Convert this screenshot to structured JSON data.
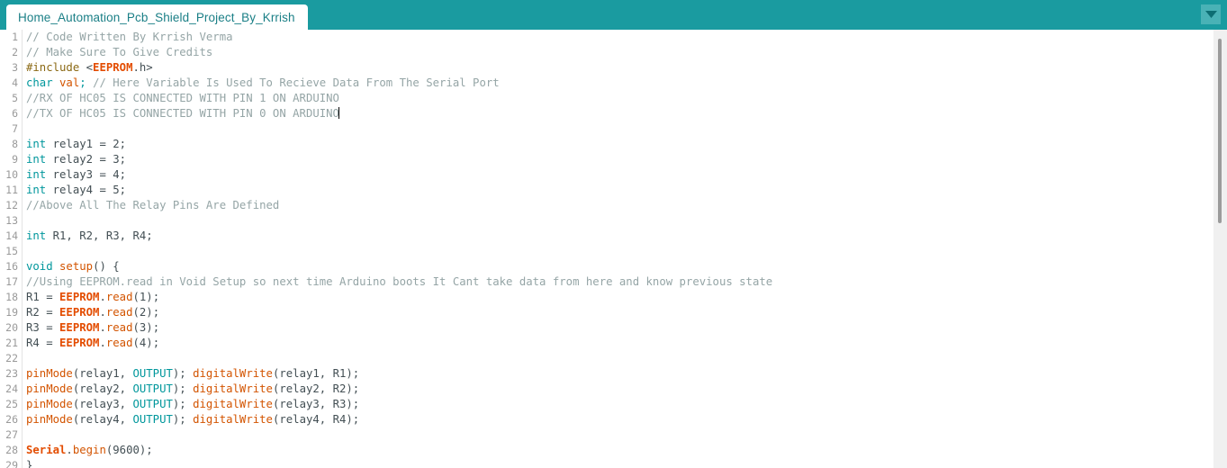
{
  "window": {
    "accent_color": "#1a9ba0",
    "tab_menu_icon": "chevron-down-icon"
  },
  "tab": {
    "label": "Home_Automation_Pcb_Shield_Project_By_Krrish"
  },
  "editor": {
    "language": "arduino-cpp",
    "caret_line": 6,
    "lines": [
      {
        "n": "1",
        "tokens": [
          {
            "t": "// Code Written By Krrish Verma",
            "c": "t-comment"
          }
        ]
      },
      {
        "n": "2",
        "tokens": [
          {
            "t": "// Make Sure To Give Credits",
            "c": "t-comment"
          }
        ]
      },
      {
        "n": "3",
        "tokens": [
          {
            "t": "#include",
            "c": "t-preproc"
          },
          {
            "t": " <",
            "c": "t-plain"
          },
          {
            "t": "EEPROM",
            "c": "t-lib"
          },
          {
            "t": ".h>",
            "c": "t-plain"
          }
        ]
      },
      {
        "n": "4",
        "tokens": [
          {
            "t": "char",
            "c": "t-keyword"
          },
          {
            "t": " ",
            "c": "t-plain"
          },
          {
            "t": "val",
            "c": "t-func"
          },
          {
            "t": ";",
            "c": "t-keyword"
          },
          {
            "t": " ",
            "c": "t-plain"
          },
          {
            "t": "// Here Variable Is Used To Recieve Data From The Serial Port",
            "c": "t-comment"
          }
        ]
      },
      {
        "n": "5",
        "tokens": [
          {
            "t": "//RX OF HC05 IS CONNECTED WITH PIN 1 ON ARDUINO",
            "c": "t-comment"
          }
        ]
      },
      {
        "n": "6",
        "tokens": [
          {
            "t": "//TX OF HC05 IS CONNECTED WITH PIN 0 ON ARDUINO",
            "c": "t-comment"
          }
        ]
      },
      {
        "n": "7",
        "tokens": [
          {
            "t": "",
            "c": "t-plain"
          }
        ]
      },
      {
        "n": "8",
        "tokens": [
          {
            "t": "int",
            "c": "t-keyword"
          },
          {
            "t": " relay1 = 2;",
            "c": "t-plain"
          }
        ]
      },
      {
        "n": "9",
        "tokens": [
          {
            "t": "int",
            "c": "t-keyword"
          },
          {
            "t": " relay2 = 3;",
            "c": "t-plain"
          }
        ]
      },
      {
        "n": "10",
        "tokens": [
          {
            "t": "int",
            "c": "t-keyword"
          },
          {
            "t": " relay3 = 4;",
            "c": "t-plain"
          }
        ]
      },
      {
        "n": "11",
        "tokens": [
          {
            "t": "int",
            "c": "t-keyword"
          },
          {
            "t": " relay4 = 5;",
            "c": "t-plain"
          }
        ]
      },
      {
        "n": "12",
        "tokens": [
          {
            "t": "//Above All The Relay Pins Are Defined",
            "c": "t-comment"
          }
        ]
      },
      {
        "n": "13",
        "tokens": [
          {
            "t": "",
            "c": "t-plain"
          }
        ]
      },
      {
        "n": "14",
        "tokens": [
          {
            "t": "int",
            "c": "t-keyword"
          },
          {
            "t": " R1, R2, R3, R4;",
            "c": "t-plain"
          }
        ]
      },
      {
        "n": "15",
        "tokens": [
          {
            "t": "",
            "c": "t-plain"
          }
        ]
      },
      {
        "n": "16",
        "tokens": [
          {
            "t": "void",
            "c": "t-keyword"
          },
          {
            "t": " ",
            "c": "t-plain"
          },
          {
            "t": "setup",
            "c": "t-func"
          },
          {
            "t": "() {",
            "c": "t-plain"
          }
        ]
      },
      {
        "n": "17",
        "tokens": [
          {
            "t": "//Using EEPROM.read in Void Setup so next time Arduino boots It Cant take data from here and know previous state",
            "c": "t-comment"
          }
        ]
      },
      {
        "n": "18",
        "tokens": [
          {
            "t": "R1 = ",
            "c": "t-plain"
          },
          {
            "t": "EEPROM",
            "c": "t-lib"
          },
          {
            "t": ".",
            "c": "t-plain"
          },
          {
            "t": "read",
            "c": "t-method"
          },
          {
            "t": "(1);",
            "c": "t-plain"
          }
        ]
      },
      {
        "n": "19",
        "tokens": [
          {
            "t": "R2 = ",
            "c": "t-plain"
          },
          {
            "t": "EEPROM",
            "c": "t-lib"
          },
          {
            "t": ".",
            "c": "t-plain"
          },
          {
            "t": "read",
            "c": "t-method"
          },
          {
            "t": "(2);",
            "c": "t-plain"
          }
        ]
      },
      {
        "n": "20",
        "tokens": [
          {
            "t": "R3 = ",
            "c": "t-plain"
          },
          {
            "t": "EEPROM",
            "c": "t-lib"
          },
          {
            "t": ".",
            "c": "t-plain"
          },
          {
            "t": "read",
            "c": "t-method"
          },
          {
            "t": "(3);",
            "c": "t-plain"
          }
        ]
      },
      {
        "n": "21",
        "tokens": [
          {
            "t": "R4 = ",
            "c": "t-plain"
          },
          {
            "t": "EEPROM",
            "c": "t-lib"
          },
          {
            "t": ".",
            "c": "t-plain"
          },
          {
            "t": "read",
            "c": "t-method"
          },
          {
            "t": "(4);",
            "c": "t-plain"
          }
        ]
      },
      {
        "n": "22",
        "tokens": [
          {
            "t": "",
            "c": "t-plain"
          }
        ]
      },
      {
        "n": "23",
        "tokens": [
          {
            "t": "pinMode",
            "c": "t-func"
          },
          {
            "t": "(relay1, ",
            "c": "t-plain"
          },
          {
            "t": "OUTPUT",
            "c": "t-const"
          },
          {
            "t": "); ",
            "c": "t-plain"
          },
          {
            "t": "digitalWrite",
            "c": "t-func"
          },
          {
            "t": "(relay1, R1);",
            "c": "t-plain"
          }
        ]
      },
      {
        "n": "24",
        "tokens": [
          {
            "t": "pinMode",
            "c": "t-func"
          },
          {
            "t": "(relay2, ",
            "c": "t-plain"
          },
          {
            "t": "OUTPUT",
            "c": "t-const"
          },
          {
            "t": "); ",
            "c": "t-plain"
          },
          {
            "t": "digitalWrite",
            "c": "t-func"
          },
          {
            "t": "(relay2, R2);",
            "c": "t-plain"
          }
        ]
      },
      {
        "n": "25",
        "tokens": [
          {
            "t": "pinMode",
            "c": "t-func"
          },
          {
            "t": "(relay3, ",
            "c": "t-plain"
          },
          {
            "t": "OUTPUT",
            "c": "t-const"
          },
          {
            "t": "); ",
            "c": "t-plain"
          },
          {
            "t": "digitalWrite",
            "c": "t-func"
          },
          {
            "t": "(relay3, R3);",
            "c": "t-plain"
          }
        ]
      },
      {
        "n": "26",
        "tokens": [
          {
            "t": "pinMode",
            "c": "t-func"
          },
          {
            "t": "(relay4, ",
            "c": "t-plain"
          },
          {
            "t": "OUTPUT",
            "c": "t-const"
          },
          {
            "t": "); ",
            "c": "t-plain"
          },
          {
            "t": "digitalWrite",
            "c": "t-func"
          },
          {
            "t": "(relay4, R4);",
            "c": "t-plain"
          }
        ]
      },
      {
        "n": "27",
        "tokens": [
          {
            "t": "",
            "c": "t-plain"
          }
        ]
      },
      {
        "n": "28",
        "tokens": [
          {
            "t": "Serial",
            "c": "t-lib"
          },
          {
            "t": ".",
            "c": "t-plain"
          },
          {
            "t": "begin",
            "c": "t-method"
          },
          {
            "t": "(9600);",
            "c": "t-plain"
          }
        ]
      },
      {
        "n": "29",
        "tokens": [
          {
            "t": "}",
            "c": "t-plain"
          }
        ]
      }
    ]
  }
}
